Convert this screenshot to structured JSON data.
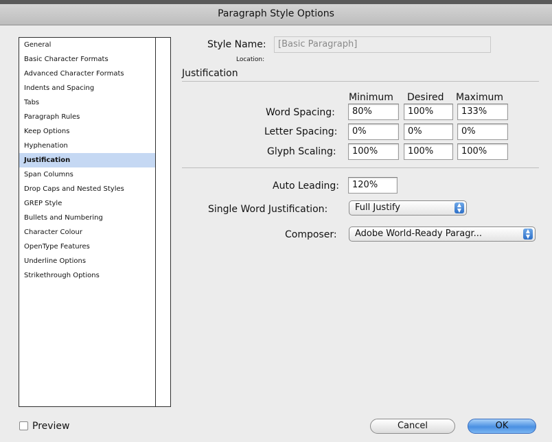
{
  "window": {
    "title": "Paragraph Style Options"
  },
  "sidebar": {
    "items": [
      {
        "label": "General"
      },
      {
        "label": "Basic Character Formats"
      },
      {
        "label": "Advanced Character Formats"
      },
      {
        "label": "Indents and Spacing"
      },
      {
        "label": "Tabs"
      },
      {
        "label": "Paragraph Rules"
      },
      {
        "label": "Keep Options"
      },
      {
        "label": "Hyphenation"
      },
      {
        "label": "Justification"
      },
      {
        "label": "Span Columns"
      },
      {
        "label": "Drop Caps and Nested Styles"
      },
      {
        "label": "GREP Style"
      },
      {
        "label": "Bullets and Numbering"
      },
      {
        "label": "Character Colour"
      },
      {
        "label": "OpenType Features"
      },
      {
        "label": "Underline Options"
      },
      {
        "label": "Strikethrough Options"
      }
    ],
    "selected": "Justification"
  },
  "style": {
    "name_label": "Style Name:",
    "name_value": "[Basic Paragraph]",
    "location_label": "Location:"
  },
  "section": {
    "title": "Justification"
  },
  "grid": {
    "headers": [
      "Minimum",
      "Desired",
      "Maximum"
    ],
    "rows": [
      {
        "label": "Word Spacing:",
        "values": [
          "80%",
          "100%",
          "133%"
        ]
      },
      {
        "label": "Letter Spacing:",
        "values": [
          "0%",
          "0%",
          "0%"
        ]
      },
      {
        "label": "Glyph Scaling:",
        "values": [
          "100%",
          "100%",
          "100%"
        ]
      }
    ]
  },
  "auto_leading": {
    "label": "Auto Leading:",
    "value": "120%"
  },
  "single_word": {
    "label": "Single Word Justification:",
    "value": "Full Justify"
  },
  "composer": {
    "label": "Composer:",
    "value": "Adobe World-Ready Paragr..."
  },
  "footer": {
    "preview_label": "Preview",
    "cancel_label": "Cancel",
    "ok_label": "OK"
  },
  "icons": {
    "select_arrows": "updown-arrows-icon",
    "checkbox": "checkbox-icon"
  },
  "colors": {
    "selection": "#c5d8f3",
    "default_button": "#4a90e2"
  }
}
